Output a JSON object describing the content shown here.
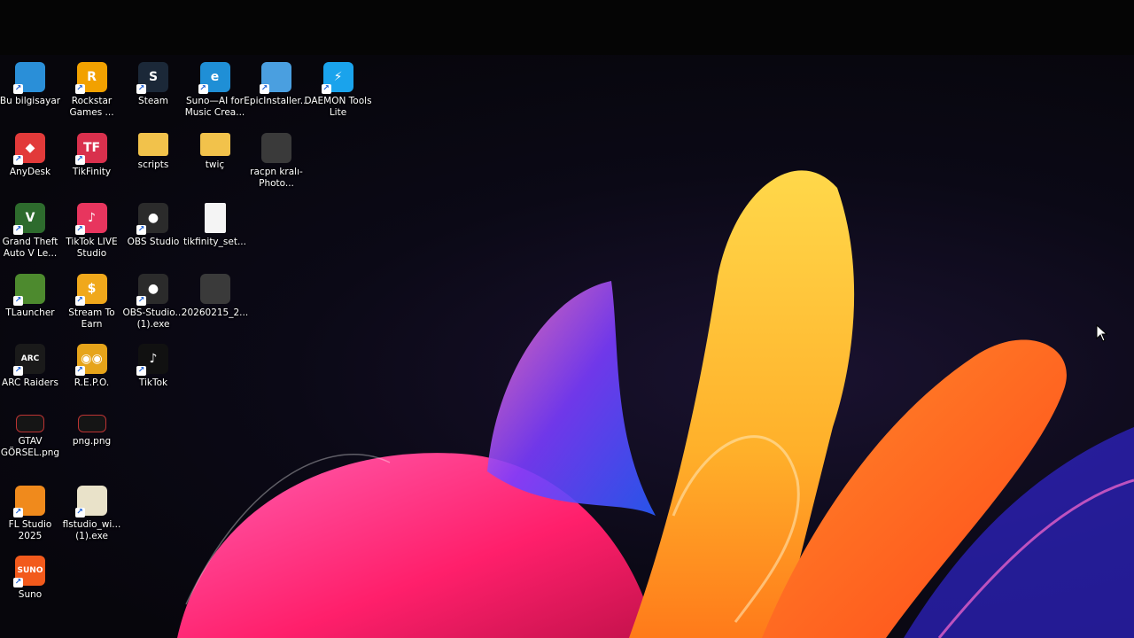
{
  "desktop": {
    "icons": [
      {
        "label": "Bu bilgisayar",
        "glyph": "",
        "color": "#2a8fd8",
        "icon": "computer-icon"
      },
      {
        "label": "Rockstar Games ...",
        "glyph": "R",
        "color": "#f2a100",
        "icon": "rockstar-icon"
      },
      {
        "label": "Steam",
        "glyph": "S",
        "color": "#1b2838",
        "icon": "steam-icon"
      },
      {
        "label": "Suno—AI for Music Crea...",
        "glyph": "e",
        "color": "#1f8fd6",
        "icon": "edge-icon"
      },
      {
        "label": "EpicInstaller...",
        "glyph": "",
        "color": "#4a9fe0",
        "icon": "installer-icon"
      },
      {
        "label": "DAEMON Tools Lite",
        "glyph": "⚡",
        "color": "#1aa3ec",
        "icon": "daemon-tools-icon"
      },
      {
        "label": "AnyDesk",
        "glyph": "◆",
        "color": "#e23a3a",
        "icon": "anydesk-icon"
      },
      {
        "label": "TikFinity",
        "glyph": "TF",
        "color": "#d9304d",
        "icon": "tikfinity-icon"
      },
      {
        "label": "scripts",
        "glyph": "",
        "color": "#f2c24b",
        "icon": "folder-icon"
      },
      {
        "label": "twiç",
        "glyph": "",
        "color": "#f2c24b",
        "icon": "folder-icon"
      },
      {
        "label": "racpn kralı-Photo...",
        "glyph": "",
        "color": "#3a3a3a",
        "icon": "image-file-icon"
      },
      {
        "label": "Grand Theft Auto V Le...",
        "glyph": "V",
        "color": "#2d6b2d",
        "icon": "gta-icon"
      },
      {
        "label": "TikTok LIVE Studio",
        "glyph": "♪",
        "color": "#e8355e",
        "icon": "tiktok-live-icon"
      },
      {
        "label": "OBS Studio",
        "glyph": "●",
        "color": "#2b2b2b",
        "icon": "obs-icon"
      },
      {
        "label": "tikfinity_set...",
        "glyph": "",
        "color": "#f4f4f4",
        "icon": "file-icon"
      },
      {
        "label": "TLauncher",
        "glyph": "",
        "color": "#4d8a2e",
        "icon": "tlauncher-icon"
      },
      {
        "label": "Stream To Earn",
        "glyph": "$",
        "color": "#f0a81b",
        "icon": "stream-to-earn-icon"
      },
      {
        "label": "OBS-Studio... (1).exe",
        "glyph": "●",
        "color": "#2b2b2b",
        "icon": "obs-installer-icon"
      },
      {
        "label": "20260215_2...",
        "glyph": "",
        "color": "#3a3a3a",
        "icon": "video-file-icon"
      },
      {
        "label": "ARC Raiders",
        "glyph": "ARC",
        "color": "#1a1a1a",
        "icon": "arc-raiders-icon"
      },
      {
        "label": "R.E.P.O.",
        "glyph": "◉◉",
        "color": "#e6a41a",
        "icon": "repo-icon"
      },
      {
        "label": "TikTok",
        "glyph": "♪",
        "color": "#111111",
        "icon": "tiktok-icon"
      },
      {
        "label": "GTAV GÖRSEL.png",
        "glyph": "",
        "color": "#151515",
        "icon": "png-file-icon"
      },
      {
        "label": "png.png",
        "glyph": "",
        "color": "#151515",
        "icon": "png-file-icon"
      },
      {
        "label": "FL Studio 2025",
        "glyph": "",
        "color": "#f08a1c",
        "icon": "fl-studio-icon"
      },
      {
        "label": "flstudio_wi... (1).exe",
        "glyph": "",
        "color": "#e9e2c9",
        "icon": "installer-icon"
      },
      {
        "label": "Suno",
        "glyph": "SUNO",
        "color": "#f25a1c",
        "icon": "suno-icon"
      }
    ]
  },
  "colors": {
    "wallpaper_bg": "#0b0916",
    "accent_pink": "#ff2e88",
    "accent_orange": "#ff7a1a",
    "accent_yellow": "#ffc02a"
  }
}
